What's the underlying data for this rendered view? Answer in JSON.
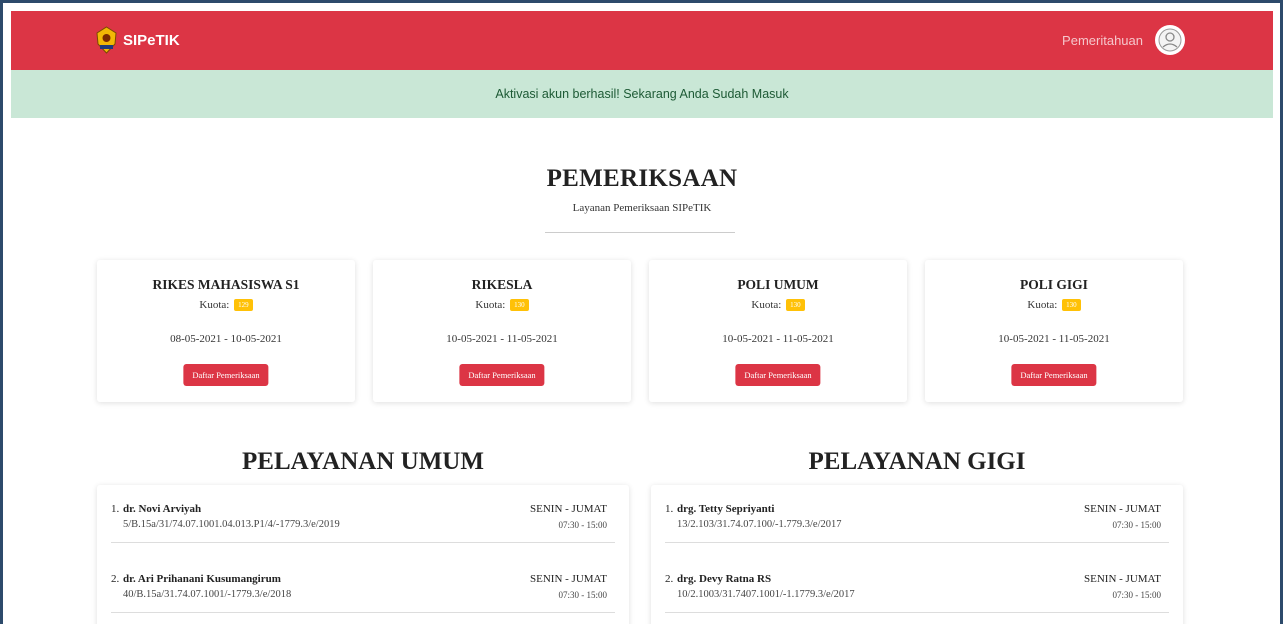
{
  "app": {
    "name": "SIPeTIK"
  },
  "nav": {
    "notifications_label": "Pemeritahuan"
  },
  "alert": {
    "message": "Aktivasi akun berhasil! Sekarang Anda Sudah Masuk"
  },
  "exams": {
    "title": "PEMERIKSAAN",
    "subtitle": "Layanan Pemeriksaan SIPeTIK",
    "quota_label": "Kuota:",
    "button_label": "Daftar Pemeriksaan",
    "items": [
      {
        "name": "RIKES MAHASISWA S1",
        "quota": "129",
        "dates": "08-05-2021 - 10-05-2021"
      },
      {
        "name": "RIKESLA",
        "quota": "130",
        "dates": "10-05-2021 - 11-05-2021"
      },
      {
        "name": "POLI UMUM",
        "quota": "130",
        "dates": "10-05-2021 - 11-05-2021"
      },
      {
        "name": "POLI GIGI",
        "quota": "130",
        "dates": "10-05-2021 - 11-05-2021"
      }
    ]
  },
  "services": {
    "general": {
      "title": "PELAYANAN UMUM",
      "doctors": [
        {
          "num": "1.",
          "name": "dr. Novi Arviyah",
          "id": "5/B.15a/31/74.07.1001.04.013.P1/4/-1779.3/e/2019",
          "days": "SENIN - JUMAT",
          "time": "07:30 - 15:00"
        },
        {
          "num": "2.",
          "name": "dr. Ari Prihanani Kusumangirum",
          "id": "40/B.15a/31.74.07.1001/-1779.3/e/2018",
          "days": "SENIN - JUMAT",
          "time": "07:30 - 15:00"
        }
      ]
    },
    "dental": {
      "title": "PELAYANAN GIGI",
      "doctors": [
        {
          "num": "1.",
          "name": "drg. Tetty Sepriyanti",
          "id": "13/2.103/31.74.07.100/-1.779.3/e/2017",
          "days": "SENIN - JUMAT",
          "time": "07:30 - 15:00"
        },
        {
          "num": "2.",
          "name": "drg. Devy Ratna RS",
          "id": "10/2.1003/31.7407.1001/-1.1779.3/e/2017",
          "days": "SENIN - JUMAT",
          "time": "07:30 - 15:00"
        }
      ]
    }
  },
  "colors": {
    "navbar": "#dc3545",
    "alert_bg": "#c9e7d6",
    "badge": "#ffc107",
    "button": "#dc3545"
  },
  "icons": {
    "brand": "emblem-logo-icon",
    "avatar": "user-avatar-icon"
  }
}
